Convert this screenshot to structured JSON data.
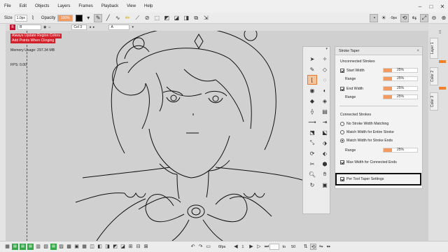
{
  "menubar": {
    "menus": [
      "File",
      "Edit",
      "Objects",
      "Layers",
      "Frames",
      "Playback",
      "View",
      "Help"
    ],
    "window_controls": [
      "minimize-icon",
      "maximize-icon",
      "close-icon"
    ]
  },
  "toolbar": {
    "size_label": "Size",
    "size_value": "1.0px",
    "opacity_label": "Opacity",
    "opacity_value": "100%",
    "swatch_color": "#000000",
    "zoom_value": "-9px"
  },
  "layer_strip": {
    "layer_badge": "B",
    "layer_name": "B",
    "cel_value": "Cel 3",
    "a_value": "A"
  },
  "canvas": {
    "warning_1": "Always Update Region Colors",
    "warning_2": "Add Points When Clinging",
    "memory_usage": "Memory Usage: 297.34 MB",
    "fps": "FPS: 0.00"
  },
  "stroke_taper": {
    "title": "Stroke Taper",
    "unconnected_header": "Unconnected Strokes",
    "start_width_label": "Start Width",
    "start_width_value": "25%",
    "start_range_label": "Range",
    "start_range_value": "25%",
    "end_width_label": "End Width",
    "end_width_value": "25%",
    "end_range_label": "Range",
    "end_range_value": "25%",
    "connected_header": "Connected Strokes",
    "opt_no_matching": "No Stroke Width Matching",
    "opt_entire": "Match Width for Entire Stroke",
    "opt_ends": "Match Width for Stroke Ends",
    "conn_range_label": "Range",
    "conn_range_value": "25%",
    "max_width_label": "Max Width for Connected Ends",
    "per_tool_label": "Per Tool Taper Settings",
    "accent": "#f39b5e"
  },
  "side_tabs": {
    "layer_tab": "Layer 1",
    "color_tab_1": "Color 2",
    "color_tab_2": "Color 3"
  },
  "bottombar": {
    "fps_label": "6fps",
    "frame_current": "1",
    "to_label": "to",
    "frame_end": "50"
  }
}
